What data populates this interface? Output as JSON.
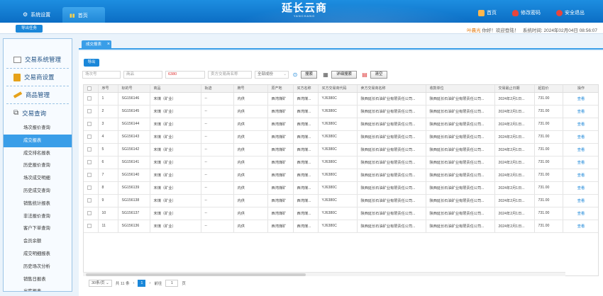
{
  "header": {
    "tabs": [
      {
        "label": "系统设置",
        "icon": "gear-icon"
      },
      {
        "label": "首页",
        "icon": "chart-bar-icon"
      }
    ],
    "logo_text": "延长云商",
    "logo_sub": "YANCHANG",
    "links": [
      {
        "label": "首页",
        "icon": "home-icon"
      },
      {
        "label": "修改密码",
        "icon": "shield-icon"
      },
      {
        "label": "安全退出",
        "icon": "exit-icon"
      }
    ]
  },
  "subbar": {
    "export_task": "导出任务",
    "user": "叶晨光",
    "greeting": "你好！欢迎登陆！",
    "time_label": "系统时间:",
    "time": "2024年02月04日 08:56:07"
  },
  "sidebar": {
    "sections": [
      {
        "label": "交易系统管理",
        "icon": "monitor-icon"
      },
      {
        "label": "交易商设置",
        "icon": "book-icon"
      },
      {
        "label": "商品管理",
        "icon": "pen-icon"
      },
      {
        "label": "交易查询",
        "icon": "binoculars-icon"
      }
    ],
    "items": [
      "场次报价查询",
      "成交报表",
      "成交排名报表",
      "历史报价查询",
      "场次成交明细",
      "历史成交查询",
      "销售统计报表",
      "非法报价查询",
      "客户下单查询",
      "会员余额",
      "成交明细报表",
      "历史场次分析",
      "销售日报表",
      "出库报表"
    ],
    "active_index": 1
  },
  "tab": {
    "label": "成交报表",
    "close": "×"
  },
  "toolbar": {
    "export_label": "导出",
    "filters": [
      {
        "placeholder": "场次号",
        "value": ""
      },
      {
        "placeholder": "商品",
        "value": ""
      },
      {
        "placeholder": "",
        "value": "6380"
      },
      {
        "placeholder": "卖方交易商名称",
        "value": ""
      },
      {
        "placeholder": "",
        "value": "全部成份"
      }
    ],
    "search_label": "搜索",
    "advanced_label": "详细搜索",
    "clear_label": "清空"
  },
  "table": {
    "columns": [
      "序号",
      "标的号",
      "商品",
      "轨迹",
      "牌号",
      "原产地",
      "买方名称",
      "买方交易商代码",
      "卖方交易商名称",
      "收款单位",
      "交易最止日期",
      "起拍价",
      "操作"
    ],
    "rows": [
      [
        "1",
        "SG156146",
        "末煤（矿业）",
        "--",
        "内供",
        "西湾煤矿",
        "西湾煤...",
        "YJ6380C",
        "陕西延长石油矿业有限责任公司...",
        "陕西延长石油矿业有限责任公司...",
        "2024年2月1日...",
        "731.00",
        "查看"
      ],
      [
        "2",
        "SG156145",
        "末煤（矿业）",
        "--",
        "内供",
        "西湾煤矿",
        "西湾煤...",
        "YJ6380C",
        "陕西延长石油矿业有限责任公司...",
        "陕西延长石油矿业有限责任公司...",
        "2024年2月1日...",
        "731.00",
        "查看"
      ],
      [
        "3",
        "SG156144",
        "末煤（矿业）",
        "--",
        "内供",
        "西湾煤矿",
        "西湾煤...",
        "YJ6380C",
        "陕西延长石油矿业有限责任公司...",
        "陕西延长石油矿业有限责任公司...",
        "2024年2月1日...",
        "731.00",
        "查看"
      ],
      [
        "4",
        "SG156143",
        "末煤（矿业）",
        "--",
        "内供",
        "西湾煤矿",
        "西湾煤...",
        "YJ6380C",
        "陕西延长石油矿业有限责任公司...",
        "陕西延长石油矿业有限责任公司...",
        "2024年2月1日...",
        "731.00",
        "查看"
      ],
      [
        "5",
        "SG156142",
        "末煤（矿业）",
        "--",
        "内供",
        "西湾煤矿",
        "西湾煤...",
        "YJ6380C",
        "陕西延长石油矿业有限责任公司...",
        "陕西延长石油矿业有限责任公司...",
        "2024年2月1日...",
        "731.00",
        "查看"
      ],
      [
        "6",
        "SG156141",
        "末煤（矿业）",
        "--",
        "内供",
        "西湾煤矿",
        "西湾煤...",
        "YJ6380C",
        "陕西延长石油矿业有限责任公司...",
        "陕西延长石油矿业有限责任公司...",
        "2024年2月1日...",
        "731.00",
        "查看"
      ],
      [
        "7",
        "SG156140",
        "末煤（矿业）",
        "--",
        "内供",
        "西湾煤矿",
        "西湾煤...",
        "YJ6380C",
        "陕西延长石油矿业有限责任公司...",
        "陕西延长石油矿业有限责任公司...",
        "2024年2月1日...",
        "731.00",
        "查看"
      ],
      [
        "8",
        "SG156139",
        "末煤（矿业）",
        "--",
        "内供",
        "西湾煤矿",
        "西湾煤...",
        "YJ6380C",
        "陕西延长石油矿业有限责任公司...",
        "陕西延长石油矿业有限责任公司...",
        "2024年2月1日...",
        "731.00",
        "查看"
      ],
      [
        "9",
        "SG156138",
        "末煤（矿业）",
        "--",
        "内供",
        "西湾煤矿",
        "西湾煤...",
        "YJ6380C",
        "陕西延长石油矿业有限责任公司...",
        "陕西延长石油矿业有限责任公司...",
        "2024年2月1日...",
        "731.00",
        "查看"
      ],
      [
        "10",
        "SG156137",
        "末煤（矿业）",
        "--",
        "内供",
        "西湾煤矿",
        "西湾煤...",
        "YJ6380C",
        "陕西延长石油矿业有限责任公司...",
        "陕西延长石油矿业有限责任公司...",
        "2024年2月1日...",
        "731.00",
        "查看"
      ],
      [
        "11",
        "SG156136",
        "末煤（矿业）",
        "--",
        "内供",
        "西湾煤矿",
        "西湾煤...",
        "YJ6380C",
        "陕西延长石油矿业有限责任公司...",
        "陕西延长石油矿业有限责任公司...",
        "2024年2月1日...",
        "731.00",
        "查看"
      ]
    ]
  },
  "pager": {
    "page_size": "30条/页",
    "total": "共 11 条",
    "prev": "‹",
    "current": "1",
    "next": "›",
    "goto_label": "前往",
    "goto_value": "1",
    "page_unit": "页"
  },
  "colors": {
    "header": "#0b6dc4",
    "accent": "#1a87d9",
    "active": "#3a9ee8"
  }
}
